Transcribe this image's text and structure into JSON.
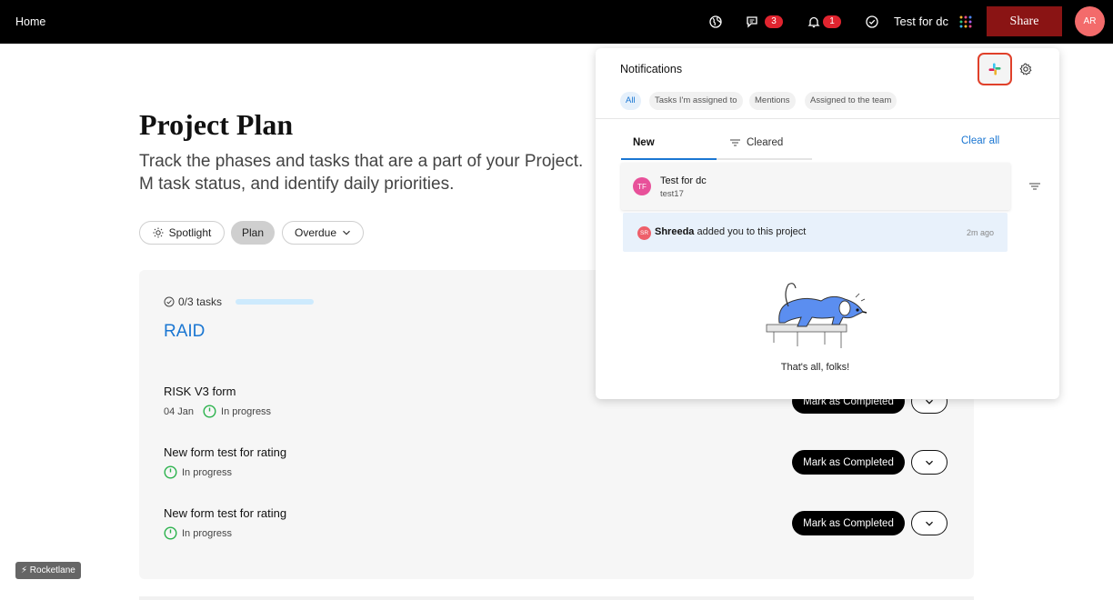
{
  "topbar": {
    "home_label": "Home",
    "chat_badge": "3",
    "bell_badge": "1",
    "workspace_name": "Test for dc",
    "share_label": "Share",
    "avatar_initials": "AR"
  },
  "page": {
    "title": "Project Plan",
    "description": "Track the phases and tasks that are a part of your Project. M task status, and identify daily priorities.",
    "filters": [
      "Spotlight",
      "Plan",
      "Overdue"
    ],
    "active_filter": "Plan"
  },
  "section": {
    "progress_label": "0/3 tasks",
    "progress_fraction": 0.0,
    "name": "RAID",
    "tasks": [
      {
        "name": "RISK V3 form",
        "date": "04 Jan",
        "status": "In progress",
        "action": "Mark as Completed"
      },
      {
        "name": "New form test for rating",
        "date": "",
        "status": "In progress",
        "action": "Mark as Completed"
      },
      {
        "name": "New form test for rating",
        "date": "",
        "status": "In progress",
        "action": "Mark as Completed"
      }
    ]
  },
  "footer_badge": "⚡ Rocketlane",
  "notifications": {
    "title": "Notifications",
    "chips": [
      "All",
      "Tasks I'm assigned to",
      "Mentions",
      "Assigned to the team"
    ],
    "active_chip": "All",
    "tabs": [
      "New",
      "Cleared"
    ],
    "active_tab": "New",
    "clear_all": "Clear all",
    "project": {
      "initials": "TF",
      "name": "Test for dc",
      "sub": "test17"
    },
    "items": [
      {
        "initials": "SR",
        "actor": "Shreeda",
        "text": " added you to this project",
        "time": "2m ago"
      }
    ],
    "empty_message": "That's all, folks!"
  },
  "colors": {
    "accent": "#1a76d2",
    "share_button": "#8a1414",
    "badge": "#e0242f",
    "status_green": "#2bb24c"
  }
}
